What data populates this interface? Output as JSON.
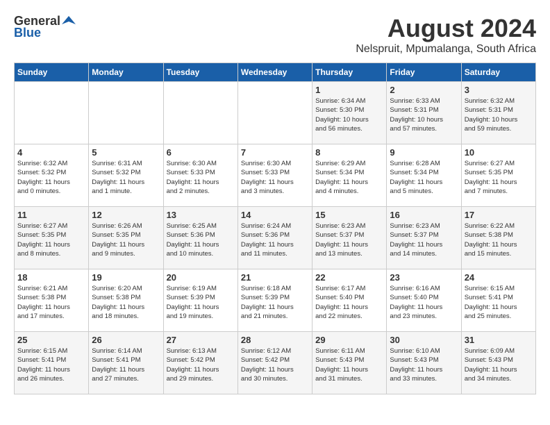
{
  "header": {
    "logo_general": "General",
    "logo_blue": "Blue",
    "month": "August 2024",
    "location": "Nelspruit, Mpumalanga, South Africa"
  },
  "weekdays": [
    "Sunday",
    "Monday",
    "Tuesday",
    "Wednesday",
    "Thursday",
    "Friday",
    "Saturday"
  ],
  "weeks": [
    [
      {
        "day": "",
        "info": ""
      },
      {
        "day": "",
        "info": ""
      },
      {
        "day": "",
        "info": ""
      },
      {
        "day": "",
        "info": ""
      },
      {
        "day": "1",
        "info": "Sunrise: 6:34 AM\nSunset: 5:30 PM\nDaylight: 10 hours\nand 56 minutes."
      },
      {
        "day": "2",
        "info": "Sunrise: 6:33 AM\nSunset: 5:31 PM\nDaylight: 10 hours\nand 57 minutes."
      },
      {
        "day": "3",
        "info": "Sunrise: 6:32 AM\nSunset: 5:31 PM\nDaylight: 10 hours\nand 59 minutes."
      }
    ],
    [
      {
        "day": "4",
        "info": "Sunrise: 6:32 AM\nSunset: 5:32 PM\nDaylight: 11 hours\nand 0 minutes."
      },
      {
        "day": "5",
        "info": "Sunrise: 6:31 AM\nSunset: 5:32 PM\nDaylight: 11 hours\nand 1 minute."
      },
      {
        "day": "6",
        "info": "Sunrise: 6:30 AM\nSunset: 5:33 PM\nDaylight: 11 hours\nand 2 minutes."
      },
      {
        "day": "7",
        "info": "Sunrise: 6:30 AM\nSunset: 5:33 PM\nDaylight: 11 hours\nand 3 minutes."
      },
      {
        "day": "8",
        "info": "Sunrise: 6:29 AM\nSunset: 5:34 PM\nDaylight: 11 hours\nand 4 minutes."
      },
      {
        "day": "9",
        "info": "Sunrise: 6:28 AM\nSunset: 5:34 PM\nDaylight: 11 hours\nand 5 minutes."
      },
      {
        "day": "10",
        "info": "Sunrise: 6:27 AM\nSunset: 5:35 PM\nDaylight: 11 hours\nand 7 minutes."
      }
    ],
    [
      {
        "day": "11",
        "info": "Sunrise: 6:27 AM\nSunset: 5:35 PM\nDaylight: 11 hours\nand 8 minutes."
      },
      {
        "day": "12",
        "info": "Sunrise: 6:26 AM\nSunset: 5:35 PM\nDaylight: 11 hours\nand 9 minutes."
      },
      {
        "day": "13",
        "info": "Sunrise: 6:25 AM\nSunset: 5:36 PM\nDaylight: 11 hours\nand 10 minutes."
      },
      {
        "day": "14",
        "info": "Sunrise: 6:24 AM\nSunset: 5:36 PM\nDaylight: 11 hours\nand 11 minutes."
      },
      {
        "day": "15",
        "info": "Sunrise: 6:23 AM\nSunset: 5:37 PM\nDaylight: 11 hours\nand 13 minutes."
      },
      {
        "day": "16",
        "info": "Sunrise: 6:23 AM\nSunset: 5:37 PM\nDaylight: 11 hours\nand 14 minutes."
      },
      {
        "day": "17",
        "info": "Sunrise: 6:22 AM\nSunset: 5:38 PM\nDaylight: 11 hours\nand 15 minutes."
      }
    ],
    [
      {
        "day": "18",
        "info": "Sunrise: 6:21 AM\nSunset: 5:38 PM\nDaylight: 11 hours\nand 17 minutes."
      },
      {
        "day": "19",
        "info": "Sunrise: 6:20 AM\nSunset: 5:38 PM\nDaylight: 11 hours\nand 18 minutes."
      },
      {
        "day": "20",
        "info": "Sunrise: 6:19 AM\nSunset: 5:39 PM\nDaylight: 11 hours\nand 19 minutes."
      },
      {
        "day": "21",
        "info": "Sunrise: 6:18 AM\nSunset: 5:39 PM\nDaylight: 11 hours\nand 21 minutes."
      },
      {
        "day": "22",
        "info": "Sunrise: 6:17 AM\nSunset: 5:40 PM\nDaylight: 11 hours\nand 22 minutes."
      },
      {
        "day": "23",
        "info": "Sunrise: 6:16 AM\nSunset: 5:40 PM\nDaylight: 11 hours\nand 23 minutes."
      },
      {
        "day": "24",
        "info": "Sunrise: 6:15 AM\nSunset: 5:41 PM\nDaylight: 11 hours\nand 25 minutes."
      }
    ],
    [
      {
        "day": "25",
        "info": "Sunrise: 6:15 AM\nSunset: 5:41 PM\nDaylight: 11 hours\nand 26 minutes."
      },
      {
        "day": "26",
        "info": "Sunrise: 6:14 AM\nSunset: 5:41 PM\nDaylight: 11 hours\nand 27 minutes."
      },
      {
        "day": "27",
        "info": "Sunrise: 6:13 AM\nSunset: 5:42 PM\nDaylight: 11 hours\nand 29 minutes."
      },
      {
        "day": "28",
        "info": "Sunrise: 6:12 AM\nSunset: 5:42 PM\nDaylight: 11 hours\nand 30 minutes."
      },
      {
        "day": "29",
        "info": "Sunrise: 6:11 AM\nSunset: 5:43 PM\nDaylight: 11 hours\nand 31 minutes."
      },
      {
        "day": "30",
        "info": "Sunrise: 6:10 AM\nSunset: 5:43 PM\nDaylight: 11 hours\nand 33 minutes."
      },
      {
        "day": "31",
        "info": "Sunrise: 6:09 AM\nSunset: 5:43 PM\nDaylight: 11 hours\nand 34 minutes."
      }
    ]
  ]
}
